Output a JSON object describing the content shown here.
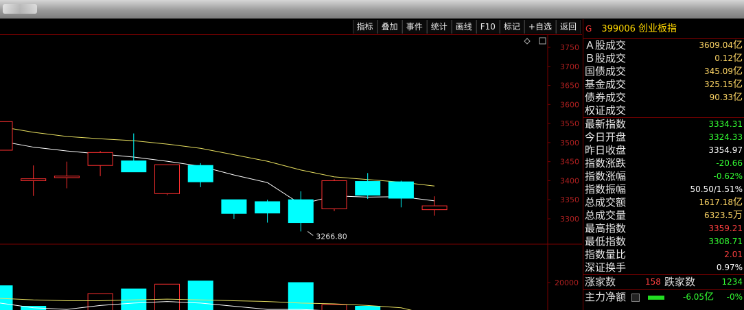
{
  "toolbar": {
    "buttons": [
      "指标",
      "叠加",
      "事件",
      "统计",
      "画线",
      "F10",
      "标记",
      "+自选",
      "返回"
    ]
  },
  "chart": {
    "price_axis": [
      "3750",
      "3700",
      "3650",
      "3600",
      "3550",
      "3500",
      "3450",
      "3400",
      "3350",
      "3300"
    ],
    "volume_axis": [
      "20000"
    ],
    "low_marker": "3266.80",
    "candles": [
      {
        "open": 3480,
        "close": 3555,
        "high": 3555,
        "low": 3480
      },
      {
        "open": 3400,
        "close": 3405,
        "high": 3440,
        "low": 3360
      },
      {
        "open": 3408,
        "close": 3412,
        "high": 3450,
        "low": 3380
      },
      {
        "open": 3440,
        "close": 3474,
        "high": 3478,
        "low": 3412
      },
      {
        "open": 3452,
        "close": 3423,
        "high": 3524,
        "low": 3423
      },
      {
        "open": 3366,
        "close": 3442,
        "high": 3442,
        "low": 3362
      },
      {
        "open": 3440,
        "close": 3397,
        "high": 3446,
        "low": 3383
      },
      {
        "open": 3350,
        "close": 3314,
        "high": 3350,
        "low": 3300
      },
      {
        "open": 3345,
        "close": 3315,
        "high": 3350,
        "low": 3290
      },
      {
        "open": 3350,
        "close": 3290,
        "high": 3372,
        "low": 3266.8
      },
      {
        "open": 3326,
        "close": 3400,
        "high": 3404,
        "low": 3320
      },
      {
        "open": 3398,
        "close": 3362,
        "high": 3420,
        "low": 3352
      },
      {
        "open": 3397,
        "close": 3354,
        "high": 3400,
        "low": 3330
      },
      {
        "open": 3324,
        "close": 3334,
        "high": 3359,
        "low": 3308
      }
    ],
    "ma_white": [
      3504,
      3488,
      3478,
      3470,
      3462,
      3451,
      3438,
      3415,
      3395,
      3338,
      3360,
      3357,
      3358,
      3347
    ],
    "ma_yellow": [
      3542,
      3527,
      3516,
      3510,
      3505,
      3496,
      3485,
      3468,
      3451,
      3428,
      3410,
      3403,
      3396,
      3386
    ],
    "volumes": [
      {
        "v": 19800,
        "up": false
      },
      {
        "v": 18500,
        "up": false
      },
      {
        "v": 18100,
        "up": true
      },
      {
        "v": 19300,
        "up": true
      },
      {
        "v": 19600,
        "up": false
      },
      {
        "v": 19900,
        "up": true
      },
      {
        "v": 20100,
        "up": false
      },
      {
        "v": 18200,
        "up": false
      },
      {
        "v": 17900,
        "up": false
      },
      {
        "v": 20000,
        "up": false
      },
      {
        "v": 18600,
        "up": true
      },
      {
        "v": 18500,
        "up": false
      },
      {
        "v": 17800,
        "up": false
      },
      {
        "v": 17200,
        "up": true
      }
    ],
    "vol_ma_white": [
      18700,
      18400,
      18300,
      18550,
      18700,
      18800,
      18700,
      18500,
      18300,
      18300,
      18200,
      18100,
      17900,
      17500
    ],
    "vol_ma_yellow": [
      19000,
      18900,
      18850,
      18850,
      18900,
      18950,
      18900,
      18850,
      18800,
      18700,
      18650,
      18550,
      18400,
      17900
    ]
  },
  "panel": {
    "g_label": "G",
    "code": "399006",
    "name": "创业板指",
    "rows": [
      {
        "label": "Ａ股成交",
        "value": "3609.04",
        "unit": "亿",
        "color": "yel"
      },
      {
        "label": "Ｂ股成交",
        "value": "0.12",
        "unit": "亿",
        "color": "yel"
      },
      {
        "label": "国债成交",
        "value": "345.09",
        "unit": "亿",
        "color": "yel"
      },
      {
        "label": "基金成交",
        "value": "325.15",
        "unit": "亿",
        "color": "yel"
      },
      {
        "label": "债券成交",
        "value": "90.33",
        "unit": "亿",
        "color": "yel"
      },
      {
        "label": "权证成交",
        "value": "",
        "unit": "",
        "color": "yel"
      }
    ],
    "rows2": [
      {
        "label": "最新指数",
        "value": "3334.31",
        "unit": "",
        "color": "grn"
      },
      {
        "label": "今日开盘",
        "value": "3324.33",
        "unit": "",
        "color": "grn"
      },
      {
        "label": "昨日收盘",
        "value": "3354.97",
        "unit": "",
        "color": "wht"
      },
      {
        "label": "指数涨跌",
        "value": "-20.66",
        "unit": "",
        "color": "grn"
      },
      {
        "label": "指数涨幅",
        "value": "-0.62%",
        "unit": "",
        "color": "grn"
      },
      {
        "label": "指数振幅",
        "value": "50.50/1.51%",
        "unit": "",
        "color": "wht"
      },
      {
        "label": "总成交额",
        "value": "1617.18",
        "unit": "亿",
        "color": "yel"
      },
      {
        "label": "总成交量",
        "value": "6323.5",
        "unit": "万",
        "color": "yel"
      },
      {
        "label": "最高指数",
        "value": "3359.21",
        "unit": "",
        "color": "red"
      },
      {
        "label": "最低指数",
        "value": "3308.71",
        "unit": "",
        "color": "grn"
      },
      {
        "label": "指数量比",
        "value": "2.01",
        "unit": "",
        "color": "red"
      },
      {
        "label": "深证换手",
        "value": "0.97%",
        "unit": "",
        "color": "wht"
      }
    ],
    "up_label": "涨家数",
    "up_value": "158",
    "down_label": "跌家数",
    "down_value": "1234",
    "capital_label": "主力净额",
    "capital_value": "-6.05",
    "capital_unit": "亿",
    "capital_pct": "-0%"
  }
}
